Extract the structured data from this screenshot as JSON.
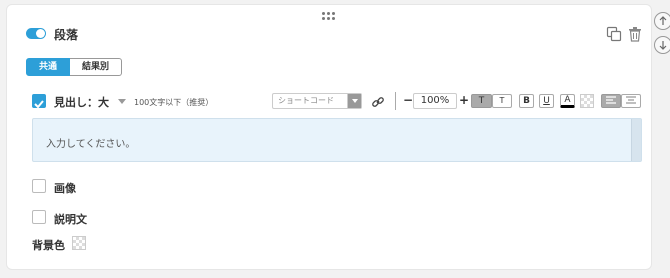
{
  "block": {
    "title": "段落",
    "enabled": true
  },
  "tabs": [
    {
      "label": "共通",
      "active": true
    },
    {
      "label": "結果別",
      "active": false
    }
  ],
  "heading": {
    "checked": true,
    "label": "見出し：大",
    "hint": "100文字以下（推奨）"
  },
  "toolbar": {
    "shortcode_placeholder": "ショートコード",
    "minus": "−",
    "plus": "+",
    "zoom": "100%",
    "size_large": "T",
    "size_small": "T",
    "bold": "B",
    "underline": "U",
    "font_color": "A"
  },
  "editor": {
    "placeholder": "入力してください。"
  },
  "options": {
    "image_label": "画像",
    "image_checked": false,
    "description_label": "説明文",
    "description_checked": false,
    "background_label": "背景色"
  },
  "colors": {
    "accent": "#2d9fd8",
    "editor_bg": "#e8f3fb"
  },
  "icons": {
    "drag": "drag-handle-icon",
    "copy": "copy-icon",
    "trash": "trash-icon",
    "up": "arrow-up-icon",
    "down": "arrow-down-icon",
    "link": "link-icon"
  }
}
